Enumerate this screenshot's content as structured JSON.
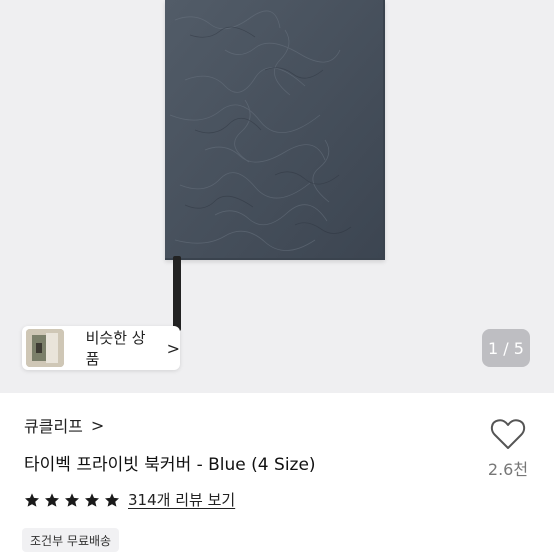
{
  "gallery": {
    "similar_label": "비슷한 상품",
    "similar_chevron": ">",
    "counter": "1 / 5"
  },
  "product": {
    "store_name": "큐클리프",
    "store_chevron": ">",
    "title": "타이벡 프라이빗 북커버 - Blue (4 Size)",
    "rating_stars": 5,
    "review_link": "314개 리뷰 보기",
    "shipping_badge": "조건부 무료배송"
  },
  "like": {
    "count": "2.6천"
  },
  "icons": {
    "like": "heart-outline-icon",
    "star": "star-icon",
    "chevron": "chevron-right-icon"
  },
  "colors": {
    "book_cover": "#46505c",
    "star": "#1a1a1a",
    "heart_outline": "#555555"
  }
}
